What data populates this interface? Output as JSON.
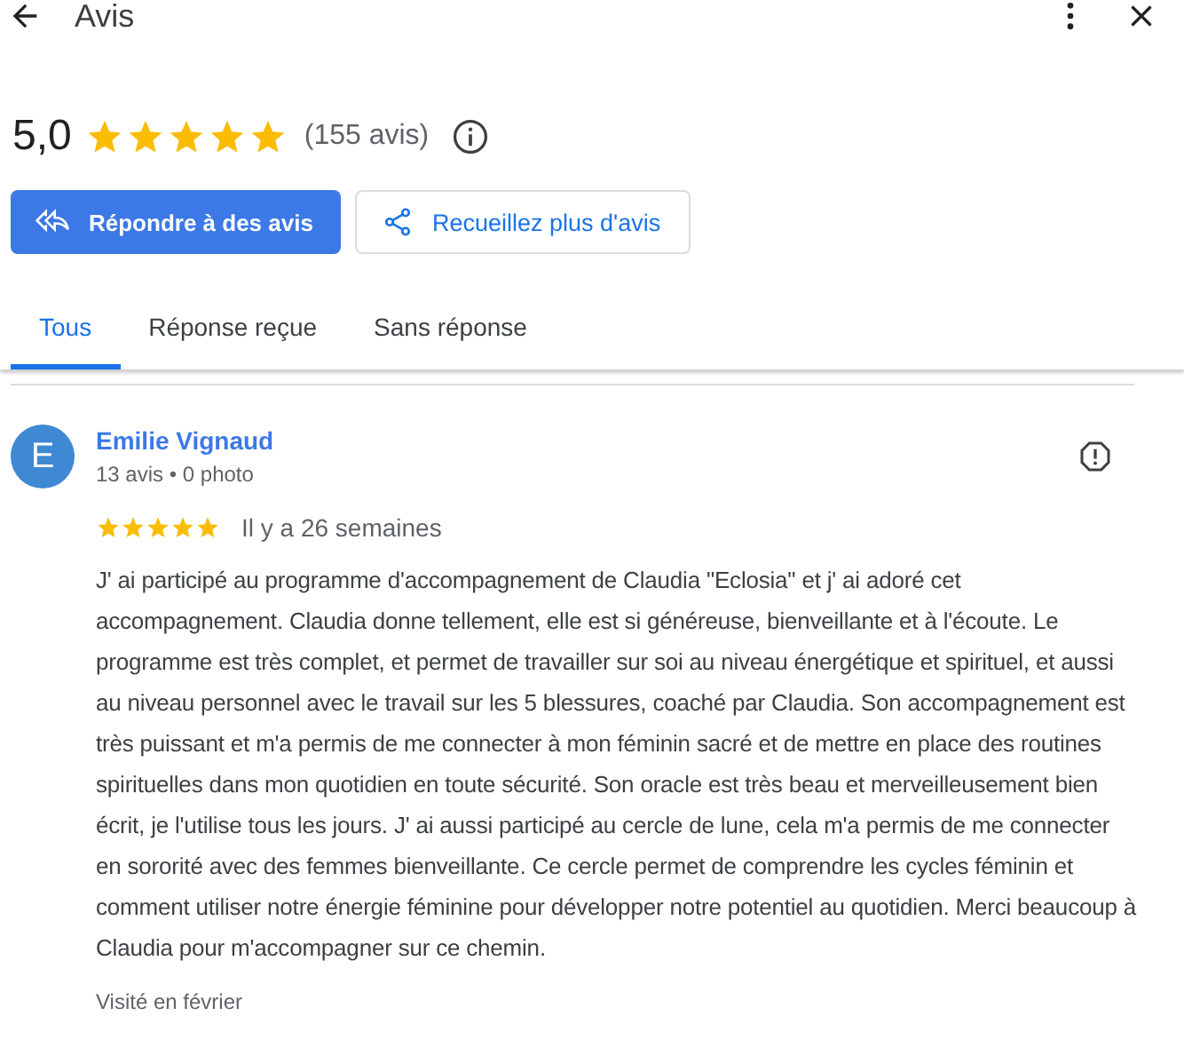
{
  "header": {
    "title": "Avis"
  },
  "summary": {
    "rating": "5,0",
    "stars": 5,
    "count": "(155 avis)"
  },
  "buttons": [
    {
      "kind": "primary",
      "label": "Répondre à des avis"
    },
    {
      "kind": "secondary",
      "label": "Recueillez plus d'avis"
    }
  ],
  "tabs": [
    {
      "label": "Tous",
      "selected": true
    },
    {
      "label": "Réponse reçue",
      "selected": false
    },
    {
      "label": "Sans réponse",
      "selected": false
    }
  ],
  "reviews": [
    {
      "avatar": "E",
      "name": "Emilie Vignaud",
      "meta": "13 avis • 0 photo",
      "stars": 5,
      "time": "Il y a 26 semaines",
      "text": "J' ai participé au programme d'accompagnement de Claudia \"Eclosia\" et j' ai adoré cet accompagnement. Claudia donne tellement, elle est si généreuse, bienveillante et à l'écoute. Le programme est très complet, et permet de travailler sur soi au niveau énergétique et spirituel, et aussi au niveau personnel avec le travail sur les 5 blessures, coaché par Claudia. Son accompagnement est très puissant et m'a permis de me connecter à mon féminin sacré et de mettre en place des routines spirituelles dans mon quotidien en toute sécurité. Son oracle est très beau et merveilleusement bien écrit, je l'utilise tous les jours. J' ai aussi participé au cercle de lune, cela m'a permis de me connecter en sororité avec des femmes bienveillante. Ce cercle permet de comprendre les cycles féminin et comment utiliser notre énergie féminine pour développer notre potentiel au quotidien. Merci beaucoup à Claudia pour m'accompagner sur ce chemin.",
      "visit": "Visité en février"
    }
  ]
}
